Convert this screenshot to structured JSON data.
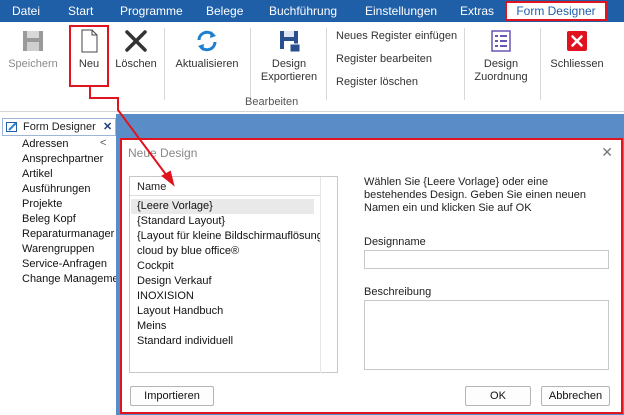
{
  "menu": {
    "items": [
      "Datei",
      "Start",
      "Programme",
      "Belege",
      "Buchführung",
      "Einstellungen",
      "Extras"
    ],
    "active": "Form Designer"
  },
  "ribbon": {
    "speichern": "Speichern",
    "neu": "Neu",
    "loeschen": "Löschen",
    "aktualisieren": "Aktualisieren",
    "design_exportieren": [
      "Design",
      "Exportieren"
    ],
    "links": [
      "Neues Register einfügen",
      "Register bearbeiten",
      "Register löschen"
    ],
    "group_label": "Bearbeiten",
    "design_zuordnung": [
      "Design",
      "Zuordnung"
    ],
    "schliessen": "Schliessen"
  },
  "left_panel": {
    "tab_title": "Form Designer",
    "items": [
      "Adressen",
      "Ansprechpartner",
      "Artikel",
      "Ausführungen",
      "Projekte",
      "Beleg Kopf",
      "Reparaturmanager",
      "Warengruppen",
      "Service-Anfragen",
      "Change Managemer"
    ]
  },
  "dialog": {
    "title": "Neue Design",
    "list_header": "Name",
    "designs": [
      "{Leere Vorlage}",
      "{Standard Layout}",
      "{Layout für kleine Bildschirmauflösung...",
      "cloud by blue office®",
      "Cockpit",
      "Design Verkauf",
      "INOXISION",
      "Layout Handbuch",
      "Meins",
      "Standard individuell"
    ],
    "selected_index": 0,
    "description": "Wählen Sie {Leere Vorlage} oder eine bestehendes Design. Geben Sie einen neuen Namen ein und klicken Sie auf OK",
    "designname_label": "Designname",
    "designname_value": "",
    "beschreibung_label": "Beschreibung",
    "beschreibung_value": "",
    "importieren": "Importieren",
    "ok": "OK",
    "abbrechen": "Abbrechen"
  },
  "colors": {
    "menubar": "#1e5fa8",
    "highlight": "#e0141e",
    "background_panel": "#5a8dc7"
  }
}
